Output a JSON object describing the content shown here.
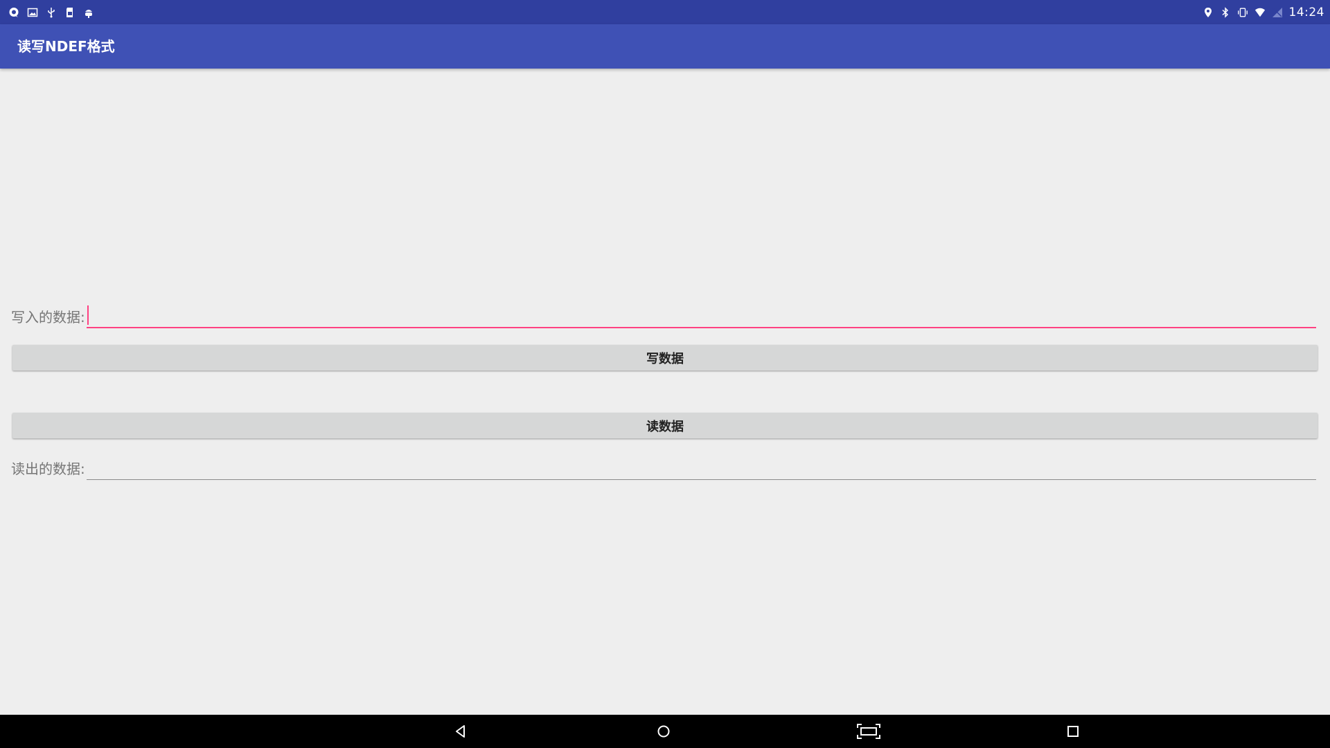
{
  "status_bar": {
    "left_icons": [
      "chat-bubble-icon",
      "image-icon",
      "usb-icon",
      "sd-card-icon",
      "android-debug-icon"
    ],
    "right_icons": [
      "location-icon",
      "bluetooth-icon",
      "vibrate-icon",
      "wifi-icon",
      "no-signal-icon"
    ],
    "time": "14:24"
  },
  "app_bar": {
    "title": "读写NDEF格式"
  },
  "write_section": {
    "label": "写入的数据:",
    "input_value": "",
    "button_label": "写数据"
  },
  "read_section": {
    "button_label": "读数据",
    "label": "读出的数据:",
    "output_value": ""
  },
  "nav_bar": {
    "buttons": [
      "back-icon",
      "home-icon",
      "screenshot-icon",
      "recents-icon"
    ]
  },
  "colors": {
    "status_bar": "#303f9f",
    "app_bar": "#3f51b5",
    "accent": "#ff4081",
    "button": "#d6d7d7",
    "background": "#eeeeee"
  }
}
